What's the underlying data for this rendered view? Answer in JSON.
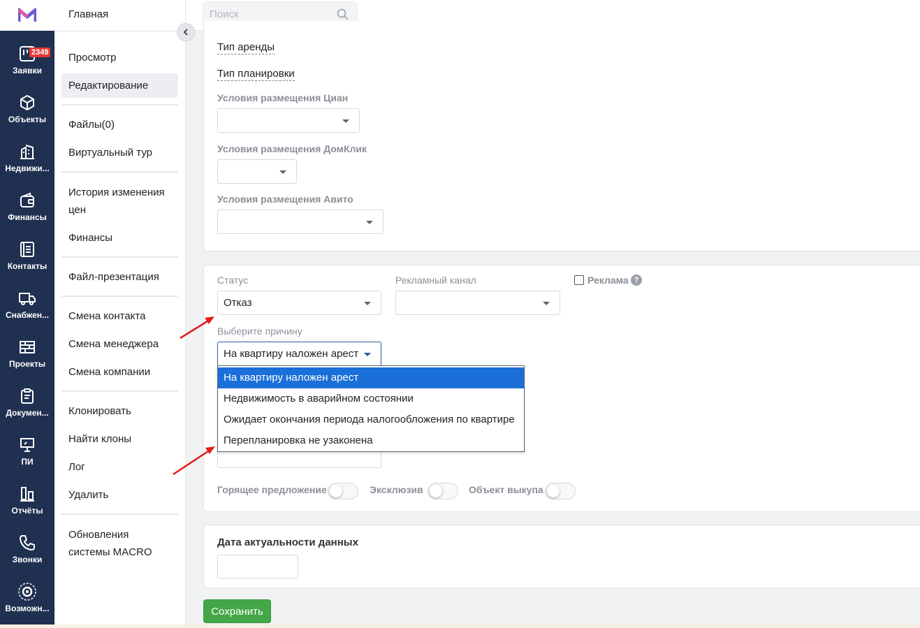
{
  "nav": {
    "items": [
      {
        "label": "Заявки",
        "icon": "requests-icon"
      },
      {
        "label": "Объекты",
        "icon": "cube-icon"
      },
      {
        "label": "Недвижи...",
        "icon": "building-icon"
      },
      {
        "label": "Финансы",
        "icon": "wallet-icon"
      },
      {
        "label": "Контакты",
        "icon": "contacts-icon"
      },
      {
        "label": "Снабжен...",
        "icon": "truck-icon"
      },
      {
        "label": "Проекты",
        "icon": "grid-icon"
      },
      {
        "label": "Докумен...",
        "icon": "clipboard-icon"
      },
      {
        "label": "ПИ",
        "icon": "presentation-icon"
      },
      {
        "label": "Отчёты",
        "icon": "bar-chart-icon"
      },
      {
        "label": "Звонки",
        "icon": "phone-icon"
      },
      {
        "label": "Возможн...",
        "icon": "gear-icon"
      }
    ],
    "badge": "2349"
  },
  "submenu": {
    "home": "Главная",
    "items": [
      "Просмотр",
      "Редактирование",
      "Файлы(0)",
      "Виртуальный тур",
      "История изменения",
      "цен",
      "Финансы",
      "Файл-презентация",
      "Смена контакта",
      "Смена менеджера",
      "Смена компании",
      "Клонировать",
      "Найти клоны",
      "Лог",
      "Удалить",
      "Обновления",
      "системы MACRO"
    ]
  },
  "search": {
    "placeholder": "Поиск"
  },
  "card1": {
    "rent_type": "Тип аренды",
    "layout_type": "Тип планировки",
    "cian_label": "Условия размещения Циан",
    "domclick_label": "Условия размещения ДомКлик",
    "avito_label": "Условия размещения Авито"
  },
  "card2": {
    "status_label": "Статус",
    "status_value": "Отказ",
    "channel_label": "Рекламный канал",
    "ads_label": "Реклама",
    "help": "?",
    "reason_label": "Выберите причину",
    "reason_value": "На квартиру наложен арест",
    "reason_options": [
      "На квартиру наложен арест",
      "Недвижимость в аварийном состоянии",
      "Ожидает окончания периода налогообложения по квартире",
      "Перепланировка не узаконена"
    ],
    "hot_label": "Горящее предложение",
    "exclusive_label": "Эксклюзив",
    "buyout_label": "Объект выкупа"
  },
  "card3": {
    "title": "Дата актуальности данных"
  },
  "actions": {
    "save": "Сохранить"
  },
  "colors": {
    "nav_bg": "#1f3050",
    "save_green": "#43a747",
    "selected_blue": "#1a6fd8",
    "badge_red": "#e53935",
    "arrow_red": "#e31b1b"
  }
}
